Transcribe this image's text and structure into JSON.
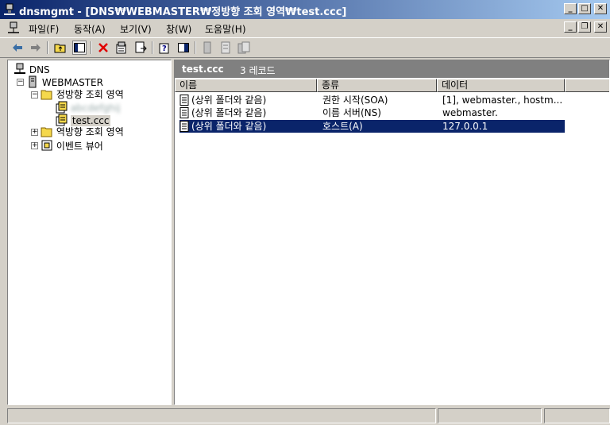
{
  "window": {
    "title": "dnsmgmt - [DNS₩WEBMASTER₩정방향 조회 영역₩test.ccc]",
    "controls": [
      "minimize",
      "maximize",
      "close"
    ]
  },
  "menubar": {
    "items": [
      "파일(F)",
      "동작(A)",
      "보기(V)",
      "창(W)",
      "도움말(H)"
    ]
  },
  "toolbar": {
    "buttons": [
      "back-icon",
      "forward-icon",
      "up-folder-icon",
      "show-tree-icon",
      "delete-icon",
      "properties-icon",
      "export-list-icon",
      "help-icon",
      "console-tree-icon",
      "new-record-icon",
      "zone-icon",
      "host-icon"
    ]
  },
  "tree": {
    "root": "DNS",
    "server": "WEBMASTER",
    "forward_zone": "정방향 조회 영역",
    "zone_hidden": "abcdefghij",
    "zone_selected": "test.ccc",
    "reverse_zone": "역방향 조회 영역",
    "event_viewer": "이벤트 뷰어"
  },
  "detail": {
    "header_title": "test.ccc",
    "header_count": "3 레코드",
    "columns": [
      "이름",
      "종류",
      "데이터"
    ],
    "records": [
      {
        "name": "(상위 폴더와 같음)",
        "type": "권한 시작(SOA)",
        "data": "[1], webmaster., hostm...",
        "selected": false
      },
      {
        "name": "(상위 폴더와 같음)",
        "type": "이름 서버(NS)",
        "data": "webmaster.",
        "selected": false
      },
      {
        "name": "(상위 폴더와 같음)",
        "type": "호스트(A)",
        "data": "127.0.0.1",
        "selected": true
      }
    ]
  },
  "statusbar": {
    "panels": [
      "",
      "",
      ""
    ]
  }
}
